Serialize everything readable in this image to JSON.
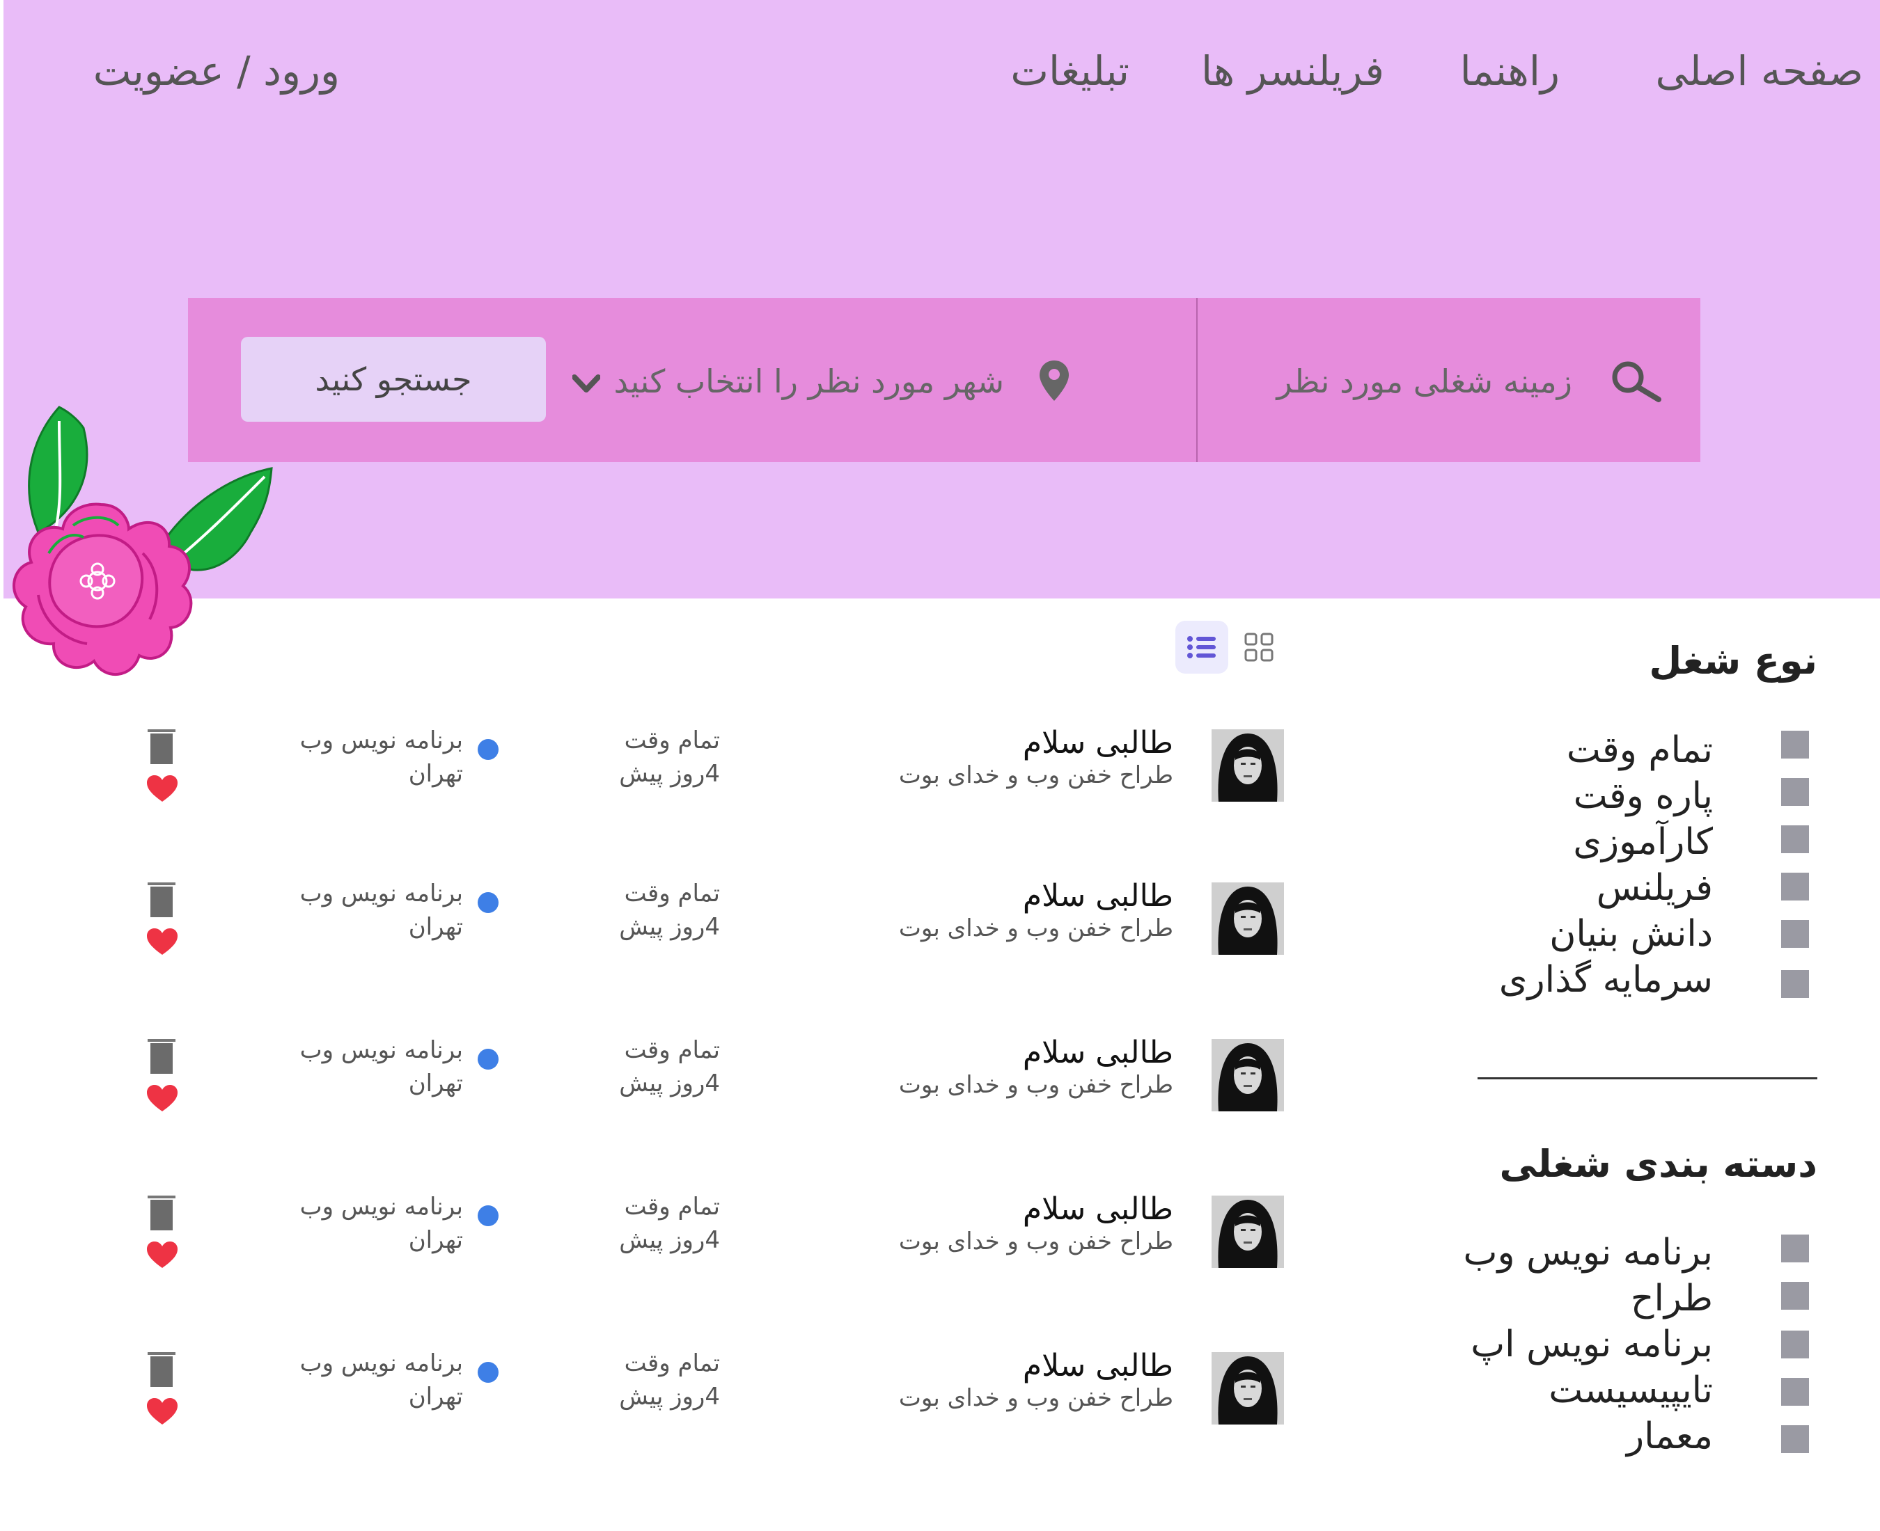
{
  "nav": {
    "home": "صفحه اصلی",
    "guide": "راهنما",
    "freelancers": "فریلنسر ها",
    "ads": "تبلیغات",
    "login": "ورود / عضویت"
  },
  "search": {
    "field_placeholder": "زمینه شغلی مورد نظر",
    "city_placeholder": "شهر مورد نظر را انتخاب کنید",
    "button_label": "جستجو کنید"
  },
  "filters": {
    "job_type_title": "نوع شغل",
    "job_types": [
      "تمام وقت",
      "پاره وقت",
      "کارآموزی",
      "فریلنس",
      "دانش بنیان",
      "سرمایه گذاری"
    ],
    "category_title": "دسته بندی شغلی",
    "categories": [
      "برنامه نویس وب",
      "طراح",
      "برنامه نویس اپ",
      "تایپیسیست",
      "معمار"
    ]
  },
  "jobs": [
    {
      "name": "طالبی سلام",
      "subtitle": "طراح خفن وب و خدای بوت",
      "type": "تمام وقت",
      "posted": "4روز پیش",
      "category": "برنامه نویس وب",
      "city": "تهران"
    },
    {
      "name": "طالبی سلام",
      "subtitle": "طراح خفن وب و خدای بوت",
      "type": "تمام وقت",
      "posted": "4روز پیش",
      "category": "برنامه نویس وب",
      "city": "تهران"
    },
    {
      "name": "طالبی سلام",
      "subtitle": "طراح خفن وب و خدای بوت",
      "type": "تمام وقت",
      "posted": "4روز پیش",
      "category": "برنامه نویس وب",
      "city": "تهران"
    },
    {
      "name": "طالبی سلام",
      "subtitle": "طراح خفن وب و خدای بوت",
      "type": "تمام وقت",
      "posted": "4روز پیش",
      "category": "برنامه نویس وب",
      "city": "تهران"
    },
    {
      "name": "طالبی سلام",
      "subtitle": "طراح خفن وب و خدای بوت",
      "type": "تمام وقت",
      "posted": "4روز پیش",
      "category": "برنامه نویس وب",
      "city": "تهران"
    }
  ],
  "icons": {
    "search": "search-icon",
    "location": "location-pin-icon",
    "dropdown": "chevron-down-icon",
    "list_view": "list-view-icon",
    "grid_view": "grid-view-icon",
    "bookmark": "bookmark-icon",
    "favorite": "heart-icon"
  },
  "colors": {
    "hero_bg": "#e9bcf8",
    "search_bar": "#e68cdc",
    "search_button": "#e6d2f7",
    "dot": "#3e7fe6",
    "heart": "#ee3344",
    "checkbox": "#9a9aa3"
  }
}
